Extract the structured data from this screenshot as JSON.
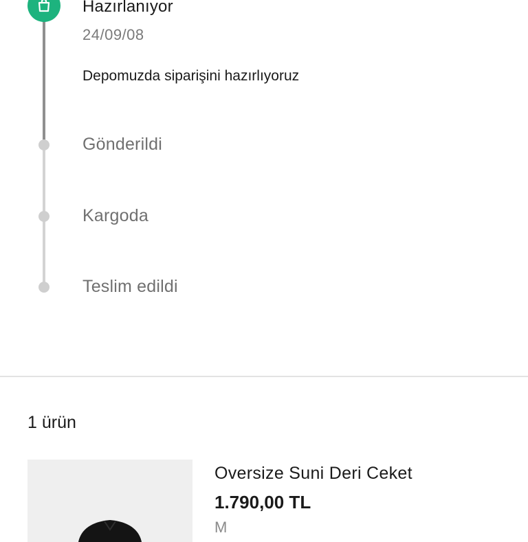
{
  "timeline": {
    "active_step": {
      "title": "Hazırlanıyor",
      "date": "24/09/08",
      "description": "Depomuzda siparişini hazırlıyoruz",
      "icon": "shopping-bag-icon",
      "color": "#1db37e"
    },
    "pending_steps": [
      {
        "title": "Gönderildi"
      },
      {
        "title": "Kargoda"
      },
      {
        "title": "Teslim edildi"
      }
    ]
  },
  "order_items": {
    "count_label": "1 ürün",
    "items": [
      {
        "name": "Oversize Suni Deri Ceket",
        "price": "1.790,00 TL",
        "size": "M"
      }
    ]
  }
}
